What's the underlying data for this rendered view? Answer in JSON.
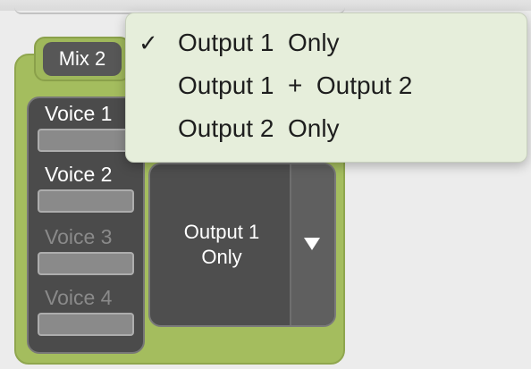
{
  "mix": {
    "label": "Mix 2"
  },
  "voices": [
    {
      "label": "Voice 1",
      "enabled": true
    },
    {
      "label": "Voice 2",
      "enabled": true
    },
    {
      "label": "Voice 3",
      "enabled": false
    },
    {
      "label": "Voice 4",
      "enabled": false
    }
  ],
  "output_select": {
    "value": "Output 1\nOnly",
    "arrow_icon": "triangle-down-icon"
  },
  "dropdown": {
    "check_mark": "✓",
    "items": [
      {
        "label": "Output 1  Only",
        "checked": true
      },
      {
        "label": "Output 1  +  Output 2",
        "checked": false
      },
      {
        "label": "Output 2  Only",
        "checked": false
      }
    ]
  },
  "colors": {
    "panel_green": "#a4bd5e",
    "menu_background": "#e6eedb",
    "dark_panel": "#4b4b4b"
  }
}
